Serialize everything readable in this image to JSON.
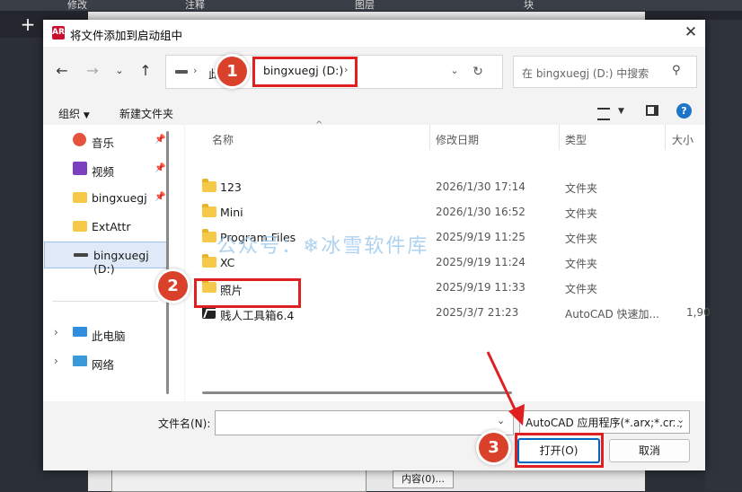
{
  "background": {
    "tabs": [
      "修改",
      "注释",
      "图层",
      "块"
    ],
    "plus": "+",
    "content_button": "内容(0)..."
  },
  "dialog": {
    "title": "将文件添加到启动组中",
    "app_icon_label": "AR",
    "address": {
      "prefix": "此",
      "drive": "bingxuegj (D:)"
    },
    "search_placeholder": "在 bingxuegj (D:) 中搜索",
    "commands": {
      "organize": "组织",
      "new_folder": "新建文件夹"
    },
    "nav": [
      {
        "label": "音乐",
        "icon": "music-icon",
        "pinned": true
      },
      {
        "label": "视频",
        "icon": "video-icon",
        "pinned": true
      },
      {
        "label": "bingxuegj",
        "icon": "folder-icon",
        "pinned": true
      },
      {
        "label": "ExtAttr",
        "icon": "folder-icon",
        "pinned": false
      },
      {
        "label": "bingxuegj (D:)",
        "icon": "drive-icon",
        "pinned": false,
        "selected": true
      },
      {
        "label": "此电脑",
        "icon": "computer-icon",
        "expandable": true
      },
      {
        "label": "网络",
        "icon": "network-icon",
        "expandable": true
      }
    ],
    "columns": [
      "名称",
      "修改日期",
      "类型",
      "大小"
    ],
    "files": [
      {
        "name": "123",
        "date": "2026/1/30 17:14",
        "type": "文件夹",
        "size": ""
      },
      {
        "name": "Mini",
        "date": "2026/1/30 16:52",
        "type": "文件夹",
        "size": ""
      },
      {
        "name": "Program Files",
        "date": "2025/9/19 11:25",
        "type": "文件夹",
        "size": ""
      },
      {
        "name": "XC",
        "date": "2025/9/19 11:24",
        "type": "文件夹",
        "size": ""
      },
      {
        "name": "照片",
        "date": "2025/9/19 11:33",
        "type": "文件夹",
        "size": ""
      },
      {
        "name": "贱人工具箱6.4",
        "date": "2025/3/7 21:23",
        "type": "AutoCAD 快速加...",
        "size": "1,90"
      }
    ],
    "filename_label": "文件名(N):",
    "filename_value": "",
    "filter": "AutoCAD 应用程序(*.arx;*.crx;",
    "open_button": "打开(O)",
    "cancel_button": "取消"
  },
  "annotations": {
    "badges": [
      "1",
      "2",
      "3"
    ],
    "watermark": "公众号：❄冰雪软件库"
  },
  "colors": {
    "accent": "#0067c0",
    "highlight_red": "#e02020",
    "badge": "#d9412b"
  }
}
